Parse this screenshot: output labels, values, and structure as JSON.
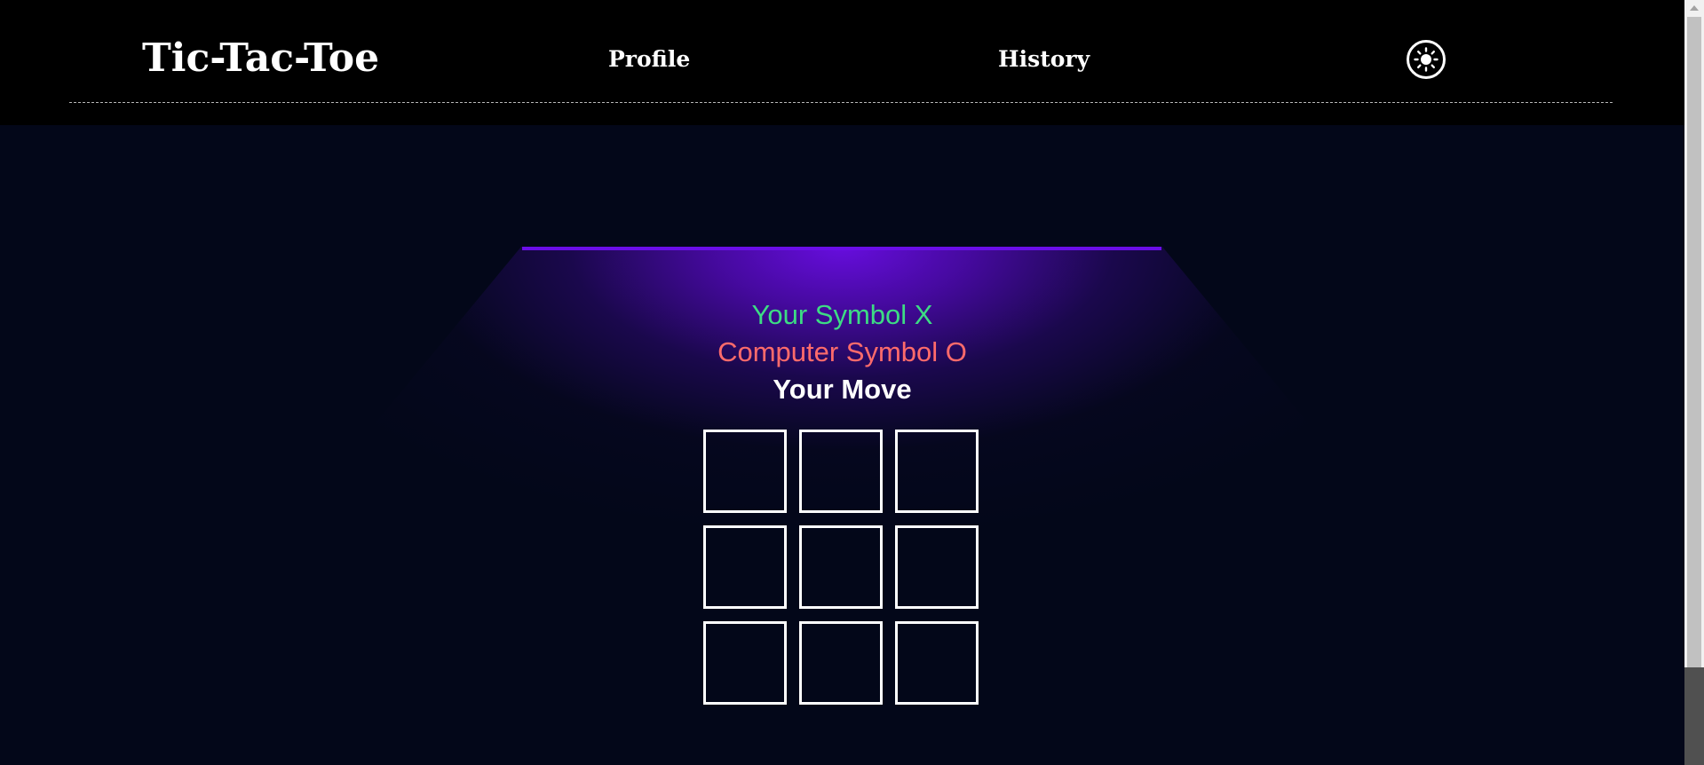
{
  "header": {
    "logo": "Tic-Tac-Toe",
    "nav": {
      "profile": "Profile",
      "history": "History"
    },
    "theme_toggle_icon": "sun-icon"
  },
  "game": {
    "player_symbol_text": "Your Symbol X",
    "computer_symbol_text": "Computer Symbol O",
    "turn_text": "Your Move",
    "board": [
      "",
      "",
      "",
      "",
      "",
      "",
      "",
      "",
      ""
    ]
  },
  "colors": {
    "background": "#030719",
    "header_bg": "#000000",
    "spotlight": "#6b0ee8",
    "player_symbol": "#3ddc84",
    "computer_symbol": "#ff6b6b",
    "turn": "#ffffff",
    "cell_border": "#ffffff"
  },
  "scrollbar": {
    "up_arrow_icon": "chevron-up-icon"
  }
}
